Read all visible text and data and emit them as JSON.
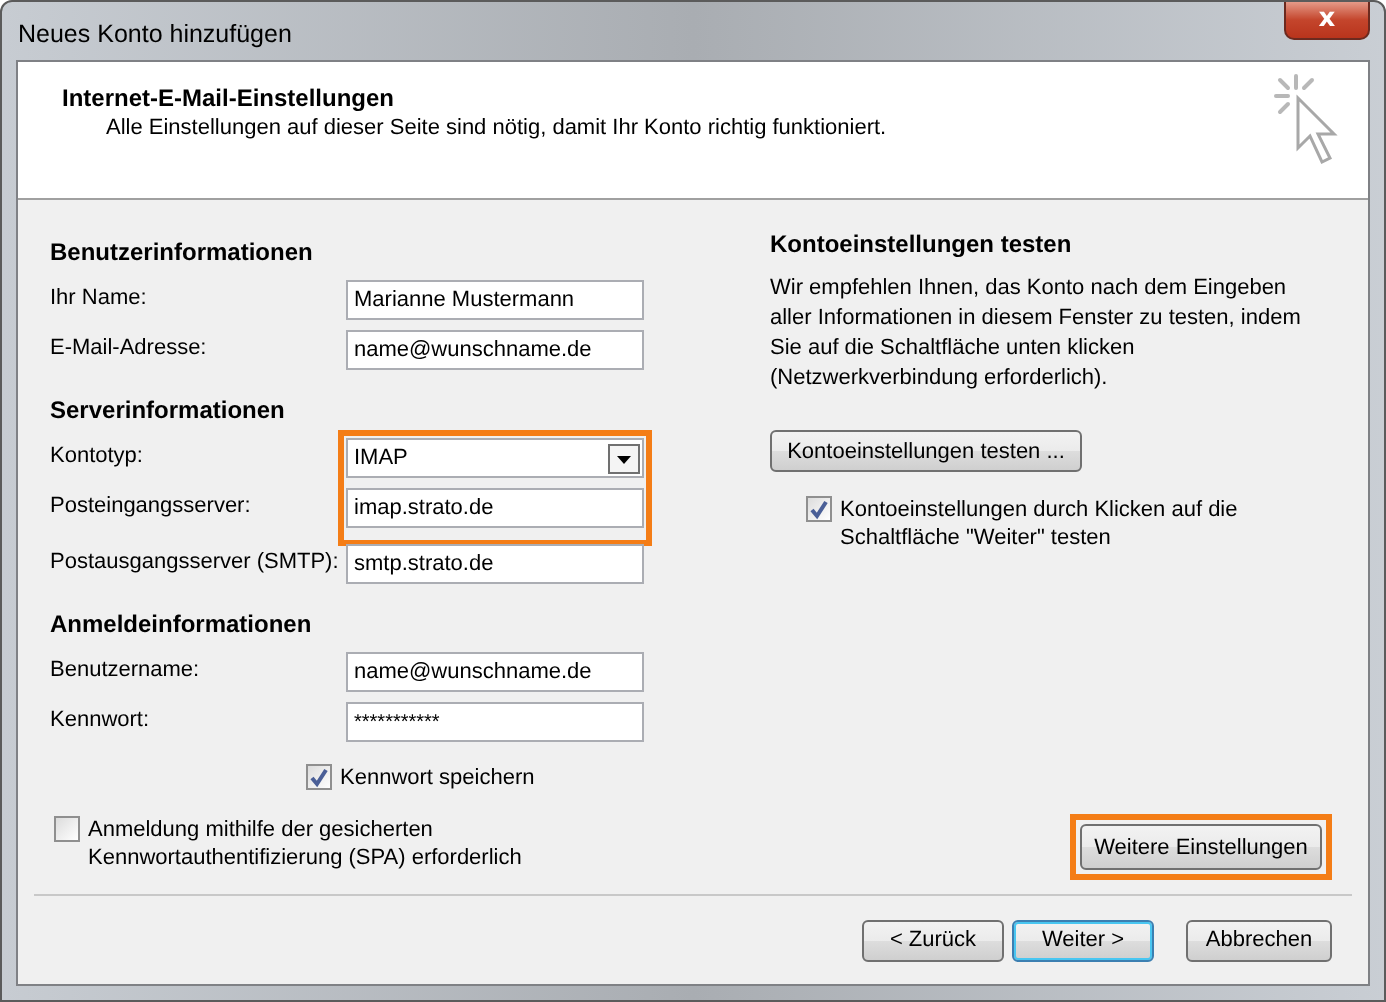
{
  "window": {
    "title": "Neues Konto hinzufügen",
    "close": "x"
  },
  "header": {
    "title": "Internet-E-Mail-Einstellungen",
    "subtitle": "Alle Einstellungen auf dieser Seite sind nötig, damit Ihr Konto richtig funktioniert."
  },
  "left": {
    "sections": [
      {
        "title": "Benutzerinformationen",
        "rows": [
          {
            "label": "Ihr Name:",
            "kind": "text",
            "value": "Marianne Mustermann",
            "highlighted": false
          },
          {
            "label": "E-Mail-Adresse:",
            "kind": "text",
            "value": "name@wunschname.de",
            "highlighted": false
          }
        ]
      },
      {
        "title": "Serverinformationen",
        "rows": [
          {
            "label": "Kontotyp:",
            "kind": "select",
            "value": "IMAP",
            "highlighted": true
          },
          {
            "label": "Posteingangsserver:",
            "kind": "text",
            "value": "imap.strato.de",
            "highlighted": true
          },
          {
            "label": "Postausgangsserver (SMTP):",
            "kind": "text",
            "value": "smtp.strato.de",
            "highlighted": false
          }
        ]
      },
      {
        "title": "Anmeldeinformationen",
        "rows": [
          {
            "label": "Benutzername:",
            "kind": "text",
            "value": "name@wunschname.de",
            "highlighted": false
          },
          {
            "label": "Kennwort:",
            "kind": "password",
            "value": "***********",
            "highlighted": false
          }
        ]
      }
    ],
    "remember": {
      "label": "Kennwort speichern",
      "checked": true
    },
    "spa": {
      "label": "Anmeldung mithilfe der gesicherten Kennwortauthentifizierung (SPA) erforderlich",
      "checked": false
    }
  },
  "right": {
    "title": "Kontoeinstellungen testen",
    "text": "Wir empfehlen Ihnen, das Konto nach dem Eingeben aller Informationen in diesem Fenster zu testen, indem Sie auf die Schaltfläche unten klicken (Netzwerkverbindung erforderlich).",
    "test_button": "Kontoeinstellungen testen ...",
    "test_on_next": {
      "label": "Kontoeinstellungen durch Klicken auf die Schaltfläche \"Weiter\" testen",
      "checked": true
    },
    "more_button": {
      "label": "Weitere Einstellungen",
      "highlighted": true
    }
  },
  "buttons": [
    {
      "label": "< Zurück",
      "default": false
    },
    {
      "label": "Weiter >",
      "default": true
    },
    {
      "label": "Abbrechen",
      "default": false
    }
  ]
}
